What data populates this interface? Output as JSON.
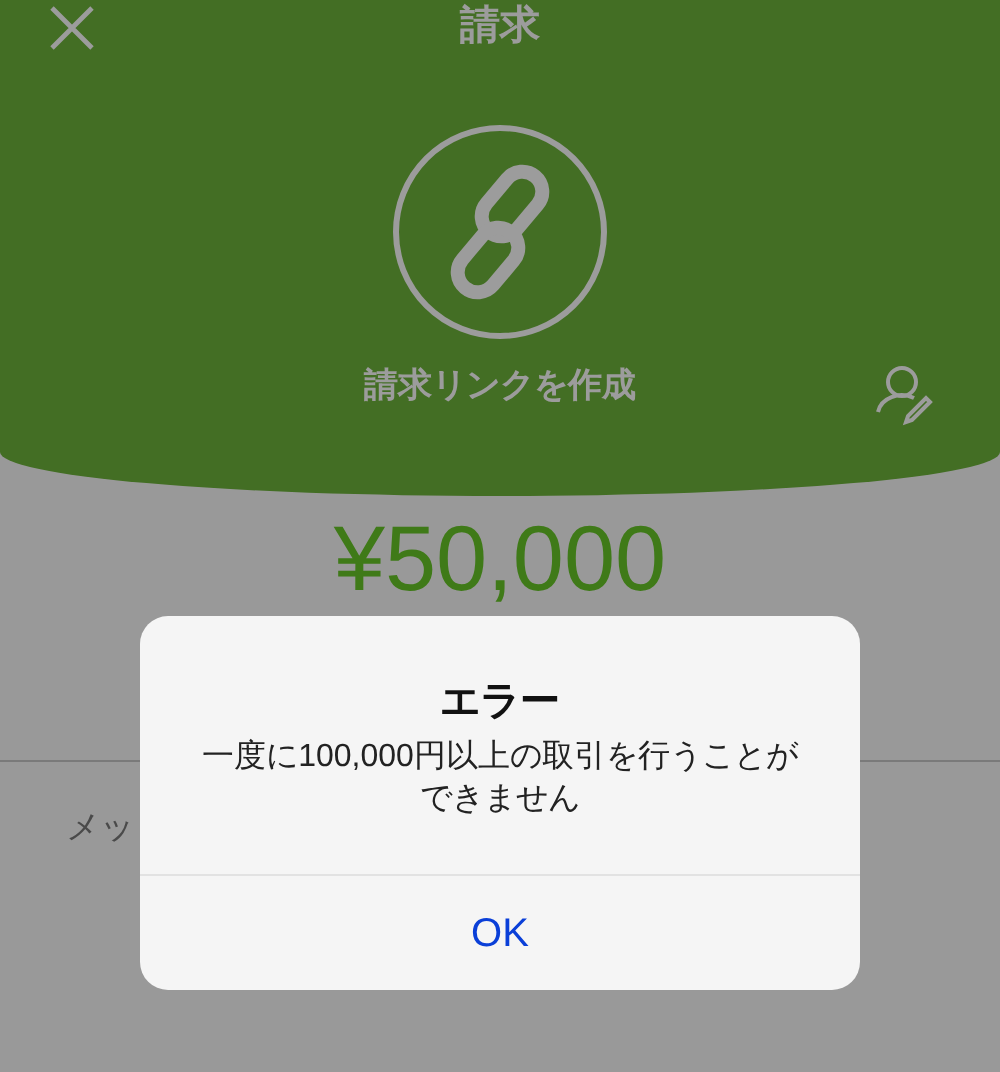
{
  "header": {
    "title": "請求",
    "link_label": "請求リンクを作成"
  },
  "amount": "¥50,000",
  "message_field": {
    "placeholder": "メッ"
  },
  "alert": {
    "title": "エラー",
    "message": "一度に100,000円以上の取引を行うことができません",
    "buttons": [
      "OK"
    ]
  }
}
